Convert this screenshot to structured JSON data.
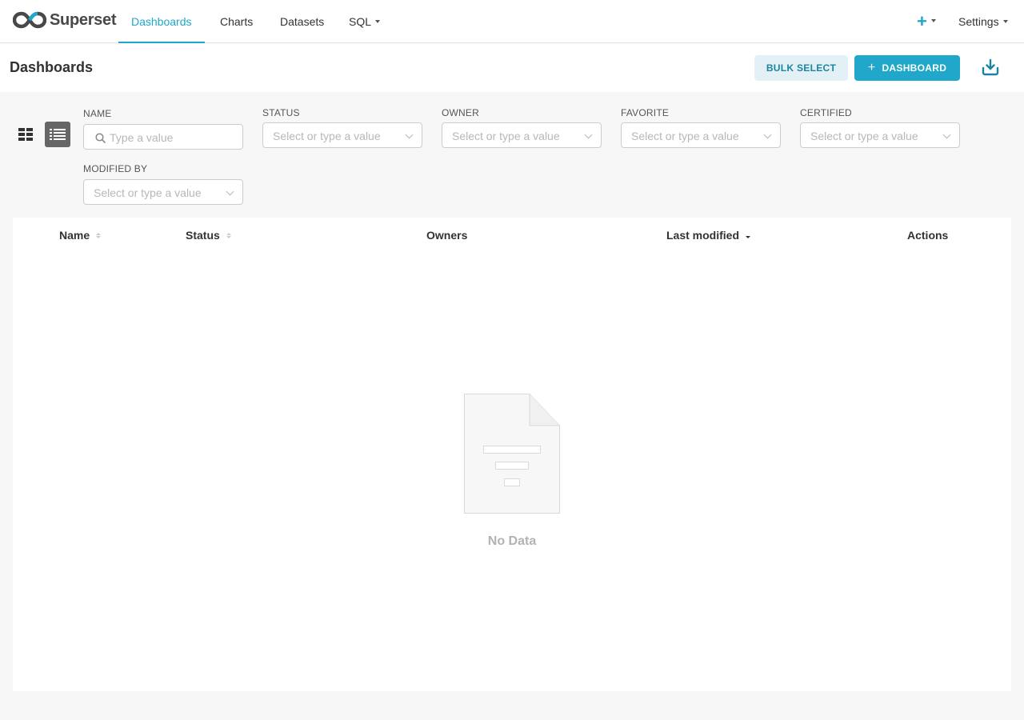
{
  "app": {
    "brand": "Superset"
  },
  "nav": {
    "items": [
      {
        "label": "Dashboards",
        "active": true
      },
      {
        "label": "Charts",
        "active": false
      },
      {
        "label": "Datasets",
        "active": false
      },
      {
        "label": "SQL",
        "active": false,
        "has_dropdown": true
      }
    ],
    "plus_icon": "plus-icon",
    "settings_label": "Settings"
  },
  "subheader": {
    "title": "Dashboards",
    "bulk_select_label": "BULK SELECT",
    "add_dashboard_label": "DASHBOARD",
    "import_icon": "import-icon"
  },
  "filters": {
    "name": {
      "label": "NAME",
      "placeholder": "Type a value"
    },
    "status": {
      "label": "STATUS",
      "placeholder": "Select or type a value"
    },
    "owner": {
      "label": "OWNER",
      "placeholder": "Select or type a value"
    },
    "favorite": {
      "label": "FAVORITE",
      "placeholder": "Select or type a value"
    },
    "certified": {
      "label": "CERTIFIED",
      "placeholder": "Select or type a value"
    },
    "modified_by": {
      "label": "MODIFIED BY",
      "placeholder": "Select or type a value"
    }
  },
  "view_mode": {
    "current": "list",
    "options": [
      "card-icon",
      "list-icon"
    ]
  },
  "table": {
    "columns": [
      "Name",
      "Status",
      "Owners",
      "Last modified",
      "Actions"
    ],
    "rows": [],
    "empty_text": "No Data"
  },
  "colors": {
    "accent": "#20a7c9",
    "bulk_bg": "#e3f1f6",
    "bulk_text": "#1a85a0",
    "background": "#f7f7f7"
  }
}
